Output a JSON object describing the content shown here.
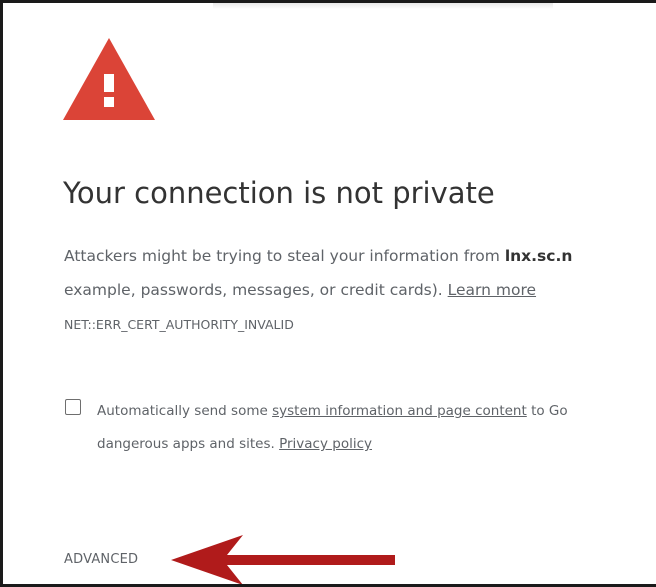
{
  "page": {
    "title": "Your connection is not private"
  },
  "warning": {
    "icon": "warning-triangle-icon",
    "icon_color": "#db4437",
    "sentence_1_prefix": "Attackers might be trying to steal your information from ",
    "domain": "lnx.sc.n",
    "sentence_2_prefix": "example, passwords, messages, or credit cards). ",
    "learn_more": "Learn more",
    "error_code": "NET::ERR_CERT_AUTHORITY_INVALID"
  },
  "report_option": {
    "checked": false,
    "text_prefix": "Automatically send some ",
    "link_system_info": "system information and page content",
    "text_suffix": " to Go",
    "line2_prefix": "dangerous apps and sites. ",
    "privacy_policy": "Privacy policy"
  },
  "advanced": {
    "label": "ADVANCED"
  },
  "annotation": {
    "arrow_color": "#b01b1b",
    "arrow_icon": "arrow-left-icon"
  }
}
